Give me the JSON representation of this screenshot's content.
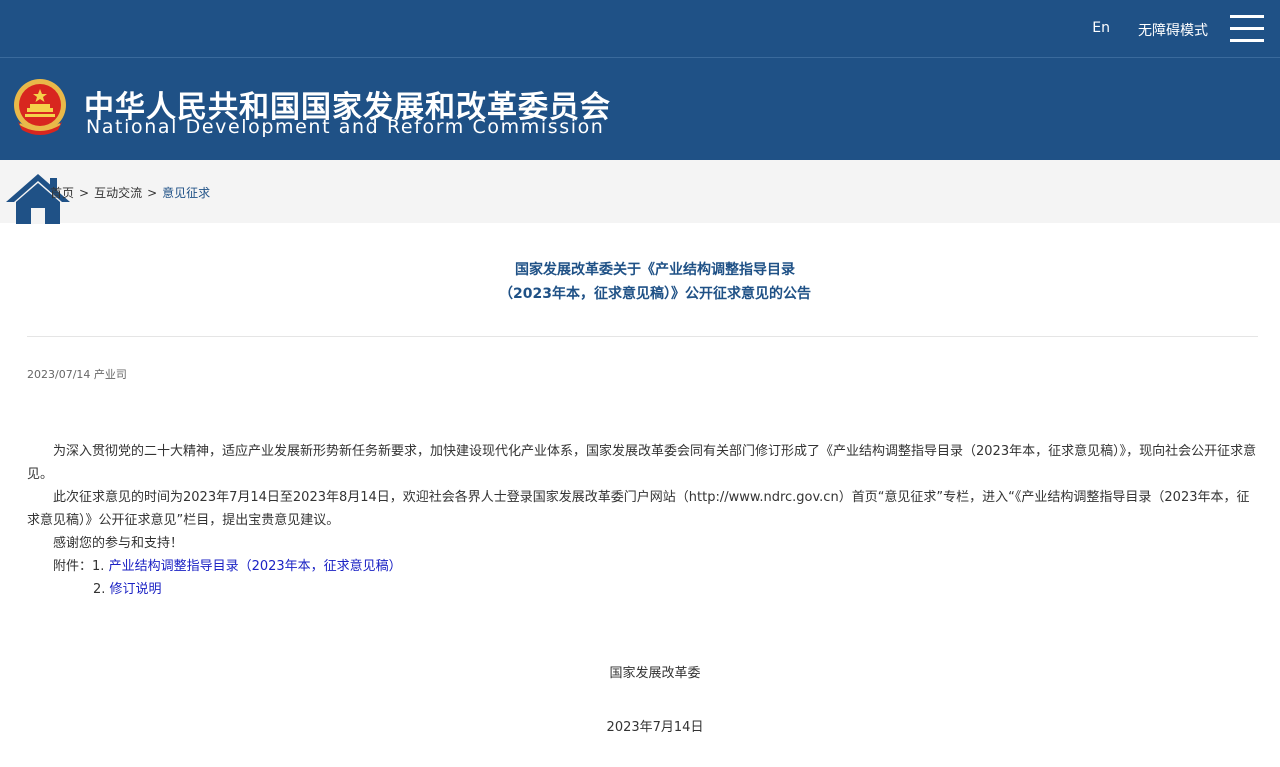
{
  "topbar": {
    "lang_link": "En",
    "accessibility_link": "无障碍模式"
  },
  "header": {
    "title_cn": "中华人民共和国国家发展和改革委员会",
    "title_en": "National Development and Reform Commission"
  },
  "breadcrumb": {
    "items": [
      "首页",
      "互动交流",
      "意见征求"
    ],
    "separator": ">"
  },
  "article": {
    "title_line1": "国家发展改革委关于《产业结构调整指导目录",
    "title_line2": "（2023年本，征求意见稿）》公开征求意见的公告",
    "meta": "2023/07/14 产业司",
    "paragraphs": [
      "为深入贯彻党的二十大精神，适应产业发展新形势新任务新要求，加快建设现代化产业体系，国家发展改革委会同有关部门修订形成了《产业结构调整指导目录（2023年本，征求意见稿）》，现向社会公开征求意见。",
      "此次征求意见的时间为2023年7月14日至2023年8月14日，欢迎社会各界人士登录国家发展改革委门户网站（http://www.ndrc.gov.cn）首页“意见征求”专栏，进入“《产业结构调整指导目录（2023年本，征求意见稿）》公开征求意见”栏目，提出宝贵意见建议。",
      "感谢您的参与和支持！"
    ],
    "attachments_label": "附件：",
    "attachments": [
      {
        "num": "1.",
        "label": "产业结构调整指导目录（2023年本，征求意见稿）"
      },
      {
        "num": "2.",
        "label": "修订说明"
      }
    ],
    "signature_org": "国家发展改革委",
    "signature_date": "2023年7月14日"
  },
  "colors": {
    "brand_blue": "#1f5186",
    "link_blue": "#1b22c4"
  }
}
